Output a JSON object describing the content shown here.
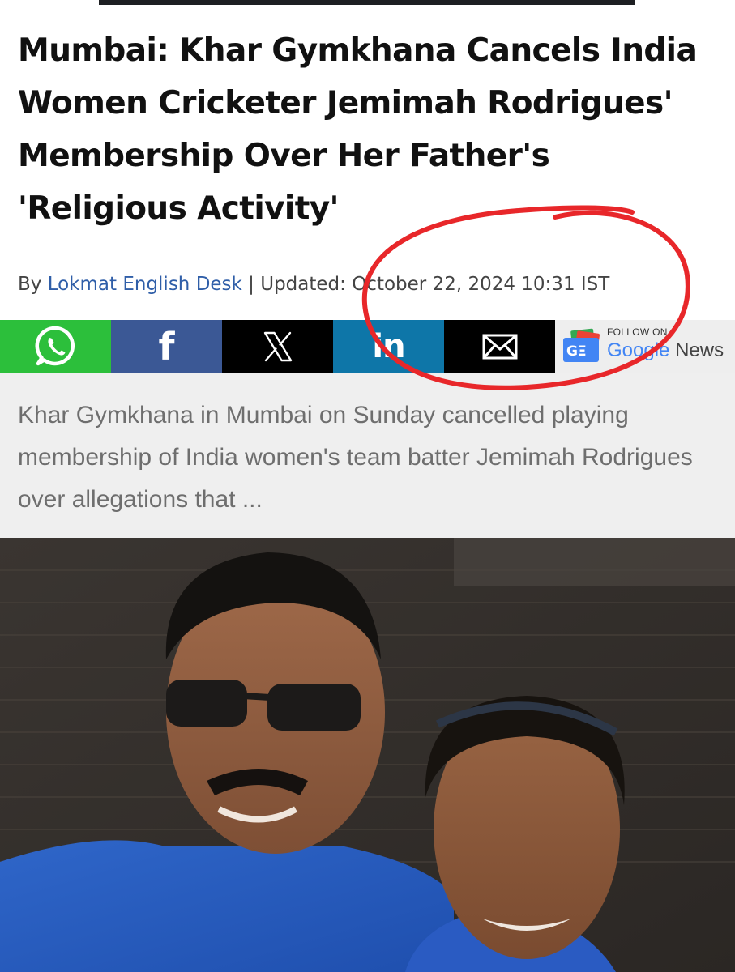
{
  "article": {
    "headline": "Mumbai: Khar Gymkhana Cancels India Women Cricketer Jemimah Rodrigues' Membership Over Her Father's 'Religious Activity'",
    "byline": {
      "by_label": "By",
      "author": "Lokmat English Desk",
      "separator": "|",
      "updated_label": "Updated:",
      "date": "October 22, 2024 10:31 IST"
    },
    "summary": "Khar Gymkhana in Mumbai on Sunday cancelled playing membership of India women's team batter Jemimah Rodrigues over allegations that ..."
  },
  "share_bar": {
    "buttons": [
      {
        "name": "whatsapp",
        "icon": "whatsapp-icon",
        "color": "#2cbf3b"
      },
      {
        "name": "facebook",
        "icon": "facebook-icon",
        "label": "f",
        "color": "#3b5895"
      },
      {
        "name": "x",
        "icon": "x-icon",
        "color": "#000000"
      },
      {
        "name": "linkedin",
        "icon": "linkedin-icon",
        "label": "in",
        "color": "#0e76a8"
      },
      {
        "name": "email",
        "icon": "mail-icon",
        "color": "#000000"
      }
    ],
    "google_news": {
      "follow_label": "FOLLOW ON",
      "google": "Google",
      "news": "News",
      "icon": "google-news-icon"
    }
  },
  "annotation": {
    "type": "hand-drawn circle around date",
    "color": "#e8272a"
  },
  "colors": {
    "author_link": "#2f5ea8",
    "headline": "#111111",
    "summary_bg": "#efefef"
  }
}
